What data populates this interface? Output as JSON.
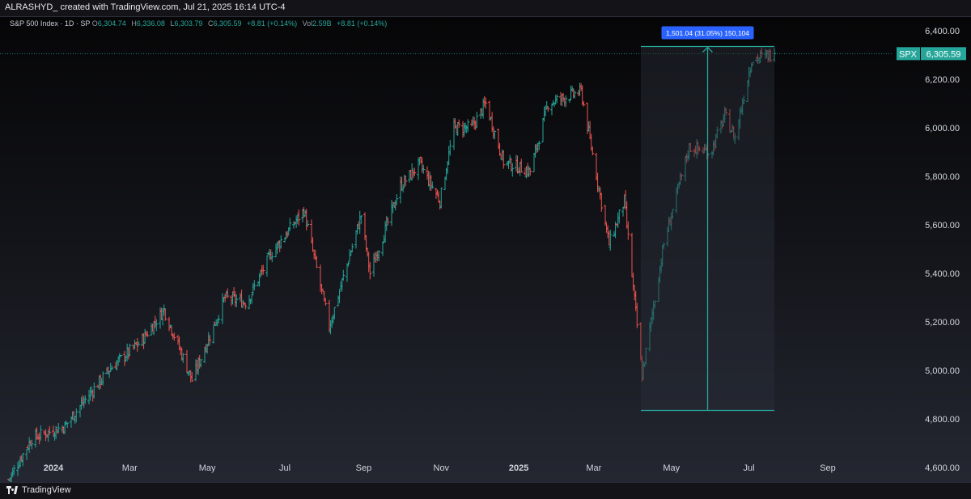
{
  "header": {
    "author_line": "ALRASHYD_ created with TradingView.com, Jul 21, 2025 16:14 UTC-4"
  },
  "legend": {
    "symbol_line": "S&P 500 Index · 1D · SP",
    "o_key": "O",
    "o_val": "6,304.74",
    "h_key": "H",
    "h_val": "6,336.08",
    "l_key": "L",
    "l_val": "6,303.79",
    "c_key": "C",
    "c_val": "6,305.59",
    "change": "+8.81 (+0.14%)",
    "vol_key": "Vol",
    "vol_val": "2.59B",
    "vol_change": "+8.81 (+0.14%)"
  },
  "footer": {
    "brand": "TradingView"
  },
  "colors": {
    "up": "#26a69a",
    "down": "#ef5350",
    "measure": "#26a69a",
    "label_bg": "#2962ff",
    "background": "#0b0b0d"
  },
  "chart_data": {
    "type": "ohlc",
    "symbol": "SPX",
    "last_price": 6305.59,
    "last_price_label": "6,305.59",
    "y_ticks": [
      "4,600.00",
      "4,800.00",
      "5,000.00",
      "5,200.00",
      "5,400.00",
      "5,600.00",
      "5,800.00",
      "6,000.00",
      "6,200.00",
      "6,400.00"
    ],
    "y_tick_values": [
      4600,
      4800,
      5000,
      5200,
      5400,
      5600,
      5800,
      6000,
      6200,
      6400
    ],
    "ylim": [
      4540,
      6460
    ],
    "x_ticks": [
      "2024",
      "Mar",
      "May",
      "Jul",
      "Sep",
      "Nov",
      "2025",
      "Mar",
      "May",
      "Jul",
      "Sep"
    ],
    "x_tick_dates": [
      "2024-01-01",
      "2024-03-01",
      "2024-05-01",
      "2024-07-01",
      "2024-09-01",
      "2024-11-01",
      "2025-01-01",
      "2025-03-01",
      "2025-05-01",
      "2025-07-01",
      "2025-09-01"
    ],
    "xlim": [
      "2023-11-20",
      "2025-10-20"
    ],
    "price_path": [
      [
        "2023-11-27",
        4550
      ],
      [
        "2023-12-15",
        4720
      ],
      [
        "2024-01-10",
        4770
      ],
      [
        "2024-01-20",
        4840
      ],
      [
        "2024-02-15",
        5010
      ],
      [
        "2024-03-10",
        5120
      ],
      [
        "2024-03-28",
        5250
      ],
      [
        "2024-04-19",
        4960
      ],
      [
        "2024-05-15",
        5300
      ],
      [
        "2024-06-01",
        5280
      ],
      [
        "2024-06-20",
        5480
      ],
      [
        "2024-07-16",
        5660
      ],
      [
        "2024-08-05",
        5180
      ],
      [
        "2024-08-30",
        5640
      ],
      [
        "2024-09-06",
        5400
      ],
      [
        "2024-09-30",
        5760
      ],
      [
        "2024-10-15",
        5850
      ],
      [
        "2024-10-31",
        5700
      ],
      [
        "2024-11-11",
        6000
      ],
      [
        "2024-11-25",
        6000
      ],
      [
        "2024-12-06",
        6100
      ],
      [
        "2024-12-20",
        5860
      ],
      [
        "2025-01-10",
        5820
      ],
      [
        "2025-01-24",
        6100
      ],
      [
        "2025-02-19",
        6150
      ],
      [
        "2025-03-13",
        5520
      ],
      [
        "2025-03-25",
        5700
      ],
      [
        "2025-04-08",
        4980
      ],
      [
        "2025-04-25",
        5520
      ],
      [
        "2025-05-15",
        5920
      ],
      [
        "2025-06-01",
        5900
      ],
      [
        "2025-06-12",
        6050
      ],
      [
        "2025-06-20",
        5960
      ],
      [
        "2025-07-03",
        6280
      ],
      [
        "2025-07-21",
        6305.59
      ]
    ],
    "measure_tool": {
      "start_date": "2025-04-07",
      "end_date": "2025-07-21",
      "low": 4835,
      "high": 6335,
      "label": "1,501.04 (31.05%) 150,104"
    }
  }
}
